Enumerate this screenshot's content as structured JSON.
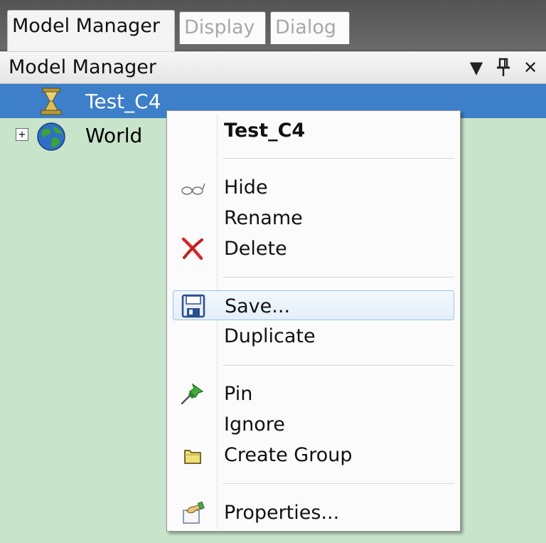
{
  "tabs": [
    {
      "label": "Model Manager",
      "active": true
    },
    {
      "label": "Display",
      "active": false
    },
    {
      "label": "Dialog",
      "active": false
    }
  ],
  "panel": {
    "title": "Model Manager",
    "dropdown_glyph": "▼",
    "pin_glyph": "⊥",
    "close_glyph": "✕"
  },
  "tree": {
    "items": [
      {
        "label": "Test_C4",
        "icon": "model-icon",
        "selected": true,
        "expander": ""
      },
      {
        "label": "World",
        "icon": "globe-icon",
        "selected": false,
        "expander": "+"
      }
    ]
  },
  "context_menu": {
    "header": "Test_C4",
    "items": {
      "hide": {
        "label": "Hide",
        "icon": "glasses-icon"
      },
      "rename": {
        "label": "Rename"
      },
      "delete": {
        "label": "Delete",
        "icon": "delete-x-icon"
      },
      "save": {
        "label": "Save...",
        "icon": "floppy-disk-icon"
      },
      "duplicate": {
        "label": "Duplicate"
      },
      "pin": {
        "label": "Pin",
        "icon": "pushpin-icon"
      },
      "ignore": {
        "label": "Ignore"
      },
      "create_group": {
        "label": "Create Group",
        "icon": "folder-icon"
      },
      "properties": {
        "label": "Properties...",
        "icon": "properties-icon"
      }
    }
  },
  "colors": {
    "selection": "#3d7fc9",
    "tree_background": "#c8e4cb",
    "menu_hover": "#e3eff9"
  }
}
